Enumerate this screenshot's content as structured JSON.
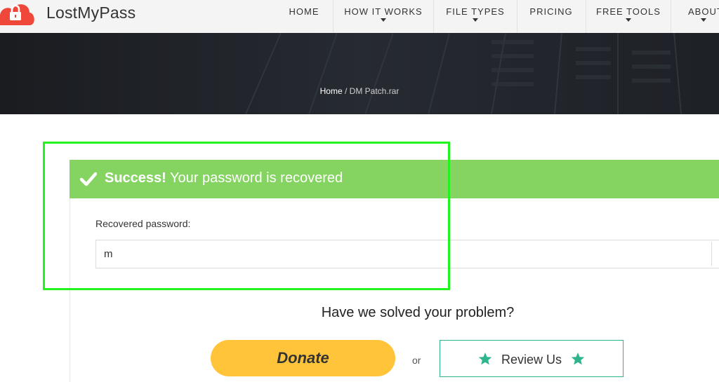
{
  "brand": {
    "name": "LostMyPass",
    "accent": "#f0473b"
  },
  "nav": {
    "items": [
      {
        "label": "HOME",
        "has_dropdown": false
      },
      {
        "label": "HOW IT WORKS",
        "has_dropdown": true
      },
      {
        "label": "FILE TYPES",
        "has_dropdown": true
      },
      {
        "label": "PRICING",
        "has_dropdown": false
      },
      {
        "label": "FREE TOOLS",
        "has_dropdown": true
      },
      {
        "label": "ABOUT",
        "has_dropdown": true
      }
    ]
  },
  "breadcrumb": {
    "home": "Home",
    "separator": " / ",
    "current": "DM Patch.rar"
  },
  "result": {
    "status_strong": "Success!",
    "status_text": " Your password is recovered",
    "password_label": "Recovered password:",
    "password_value": "m",
    "success_color": "#85d462",
    "highlight_color": "#22f51c"
  },
  "feedback": {
    "question": "Have we solved your problem?",
    "donate_label": "Donate",
    "or_text": "or",
    "review_label": "Review Us",
    "donate_color": "#ffc43a",
    "review_color": "#2fb58e"
  },
  "icons": {
    "logo": "lock-cloud-icon",
    "check": "check-icon",
    "star": "star-icon"
  }
}
